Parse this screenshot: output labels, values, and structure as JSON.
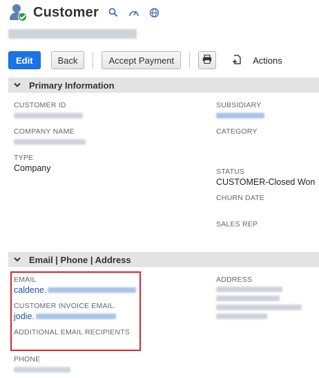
{
  "header": {
    "title": "Customer",
    "icons": [
      "search-icon",
      "dashboard-gauge-icon",
      "globe-icon"
    ]
  },
  "record": {
    "subtitle_redacted": true
  },
  "toolbar": {
    "edit_label": "Edit",
    "back_label": "Back",
    "accept_payment_label": "Accept Payment",
    "print_icon": "print-icon",
    "actions_label": "Actions"
  },
  "sections": {
    "primary": {
      "title": "Primary Information",
      "customer_id_label": "CUSTOMER ID",
      "company_name_label": "COMPANY NAME",
      "type_label": "TYPE",
      "type_value": "Company",
      "subsidiary_label": "SUBSIDIARY",
      "category_label": "CATEGORY",
      "status_label": "STATUS",
      "status_value": "CUSTOMER-Closed Won",
      "churn_date_label": "CHURN DATE",
      "sales_rep_label": "SALES REP"
    },
    "contact": {
      "title": "Email | Phone | Address",
      "email_label": "EMAIL",
      "email_value": "caldene.",
      "invoice_email_label": "CUSTOMER INVOICE EMAIL",
      "invoice_email_value": "jodie.",
      "additional_label": "ADDITIONAL EMAIL RECIPIENTS",
      "address_label": "ADDRESS",
      "phone_label": "PHONE"
    }
  },
  "colors": {
    "primary_button": "#1a73e8",
    "highlight_border": "#d6262e",
    "link": "#1f4fa3"
  }
}
